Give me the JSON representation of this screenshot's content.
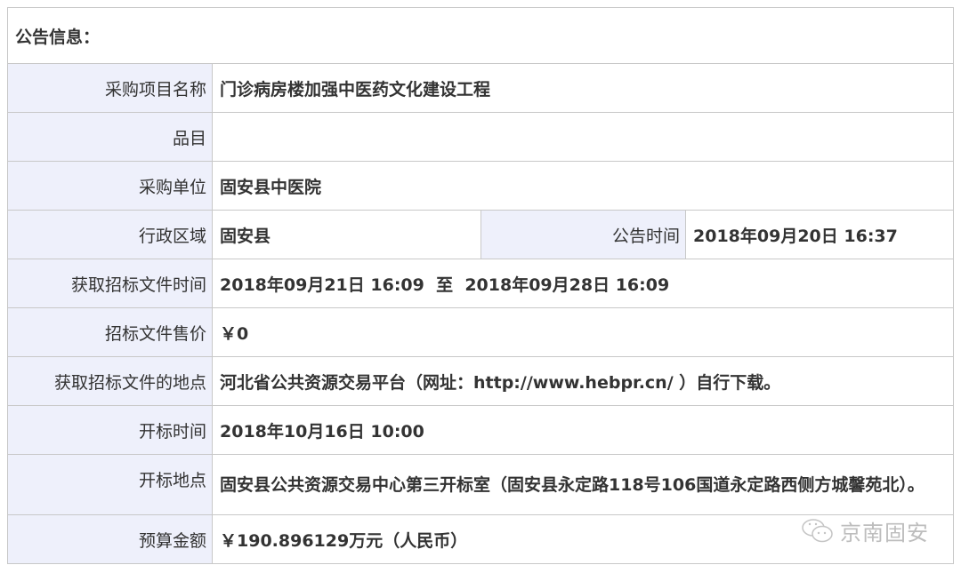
{
  "header": {
    "title": "公告信息："
  },
  "rows": [
    {
      "label": "采购项目名称",
      "value": "门诊病房楼加强中医药文化建设工程"
    },
    {
      "label": "品目",
      "value": ""
    },
    {
      "label": "采购单位",
      "value": "固安县中医院"
    },
    {
      "label": "行政区域",
      "value": "固安县",
      "label2": "公告时间",
      "value2": "2018年09月20日 16:37"
    },
    {
      "label": "获取招标文件时间",
      "value": "2018年09月21日 16:09  至  2018年09月28日 16:09"
    },
    {
      "label": "招标文件售价",
      "value": "￥0"
    },
    {
      "label": "获取招标文件的地点",
      "value": "河北省公共资源交易平台（网址：http://www.hebpr.cn/ ）自行下载。"
    },
    {
      "label": "开标时间",
      "value": "2018年10月16日 10:00"
    },
    {
      "label": "开标地点",
      "value": "固安县公共资源交易中心第三开标室（固安县永定路118号106国道永定路西侧方城馨苑北）。"
    },
    {
      "label": "预算金额",
      "value": "￥190.896129万元（人民币）"
    }
  ],
  "watermark": {
    "text": "京南固安",
    "icon": "wechat-icon"
  }
}
